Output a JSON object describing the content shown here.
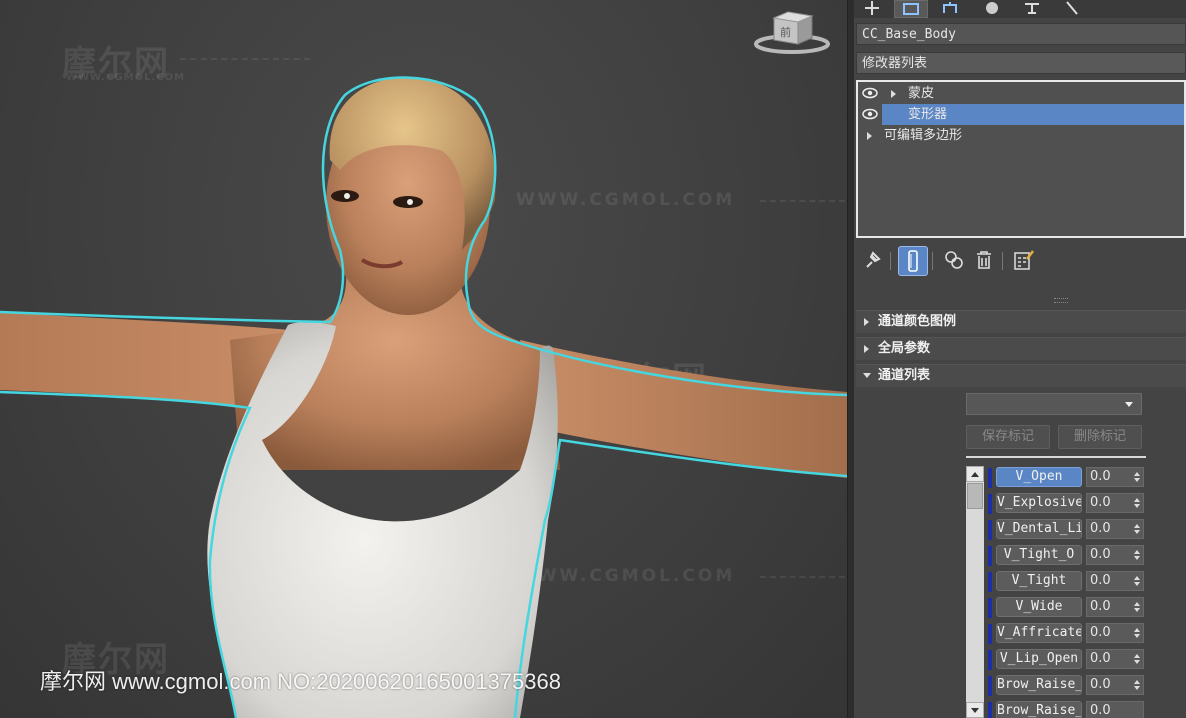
{
  "viewport": {
    "watermarks": {
      "brand_cn": "摩尔网",
      "brand_url_small": "WWW.CGMOL.COM",
      "site_url": "WWW.CGMOL.COM"
    },
    "bottom_watermark": "摩尔网 www.cgmol.com NO:20200620165001375368",
    "outline_color": "#45d6e0",
    "viewcube_label": "前"
  },
  "panel": {
    "tabs": [
      "create-icon",
      "modify-icon",
      "hierarchy-icon",
      "motion-icon",
      "display-icon",
      "utilities-icon"
    ],
    "object_name": "CC_Base_Body",
    "modifier_list_label": "修改器列表",
    "modifier_stack": [
      {
        "label": "蒙皮",
        "visible": true,
        "expandable": true,
        "selected": false
      },
      {
        "label": "变形器",
        "visible": true,
        "expandable": false,
        "selected": true
      },
      {
        "label": "可编辑多边形",
        "visible": false,
        "expandable": true,
        "selected": false
      }
    ],
    "stack_tools": [
      "pin-stack-icon",
      "show-end-result-icon",
      "make-unique-icon",
      "remove-modifier-icon",
      "configure-modifier-sets-icon"
    ],
    "rollouts": [
      {
        "label": "通道颜色图例",
        "expanded": false
      },
      {
        "label": "全局参数",
        "expanded": false
      },
      {
        "label": "通道列表",
        "expanded": true
      }
    ],
    "marker_dropdown_value": "",
    "save_marker_label": "保存标记",
    "delete_marker_label": "删除标记",
    "channels": [
      {
        "name": "V_Open",
        "value": "0.0",
        "active": true
      },
      {
        "name": "V_Explosive",
        "value": "0.0",
        "active": false
      },
      {
        "name": "V_Dental_Li",
        "value": "0.0",
        "active": false
      },
      {
        "name": "V_Tight_O",
        "value": "0.0",
        "active": false
      },
      {
        "name": "V_Tight",
        "value": "0.0",
        "active": false
      },
      {
        "name": "V_Wide",
        "value": "0.0",
        "active": false
      },
      {
        "name": "V_Affricate",
        "value": "0.0",
        "active": false
      },
      {
        "name": "V_Lip_Open",
        "value": "0.0",
        "active": false
      },
      {
        "name": "Brow_Raise_",
        "value": "0.0",
        "active": false
      },
      {
        "name": "Brow_Raise_",
        "value": "0.0",
        "active": false
      }
    ],
    "colors": {
      "selection": "#5b86c5",
      "channel_bar": "#1c2fa8"
    }
  }
}
